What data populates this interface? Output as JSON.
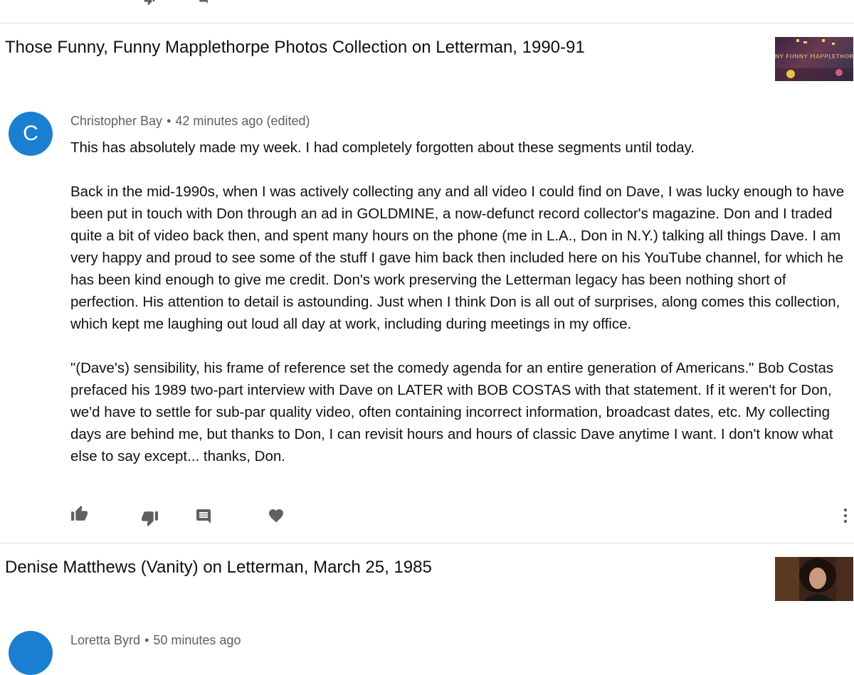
{
  "feed": {
    "items": [
      {
        "video_title": "Those Funny, Funny Mapplethorpe Photos Collection on Letterman, 1990-91",
        "thumbnail_text": "THOSE FUNNY FUNNY MAPPLETHORPE PHOTOS",
        "comment": {
          "avatar_letter": "C",
          "author": "Christopher Bay",
          "separator": "•",
          "time": "42 minutes ago (edited)",
          "paragraphs": [
            "This has absolutely made my week.  I had completely forgotten about these segments until today.",
            "Back in the mid-1990s, when I was actively collecting any and all video I could find on Dave, I was lucky enough to have been put in touch with Don through an ad in GOLDMINE, a now-defunct record collector's magazine. Don and I traded quite a bit of video back then, and spent many hours on the phone (me in L.A., Don in N.Y.) talking all things Dave. I am very happy and proud to see some of the stuff I gave him back then included here on his YouTube channel, for which he has been kind enough to give me credit.  Don's work preserving the Letterman legacy has been nothing short of perfection. His attention to detail is astounding. Just when I think Don is all out of surprises, along comes this collection, which kept me laughing out loud all day at work, including during meetings in my office.",
            "\"(Dave's) sensibility, his frame of reference set the comedy agenda for an entire generation of Americans.\" Bob Costas prefaced his 1989 two-part interview with Dave on LATER with BOB COSTAS with that statement. If it weren't for Don, we'd have to settle for sub-par quality video, often containing incorrect information, broadcast dates, etc. My collecting days are behind me, but thanks to Don, I can revisit hours and hours of classic Dave anytime I want. I don't know what else to say except... thanks, Don."
          ],
          "actions": [
            "like-icon",
            "dislike-icon",
            "reply-icon",
            "heart-icon",
            "more-menu-icon"
          ]
        }
      },
      {
        "video_title": "Denise Matthews (Vanity) on Letterman, March 25, 1985",
        "comment": {
          "author": "Loretta Byrd",
          "separator": "•",
          "time": "50 minutes ago"
        }
      }
    ]
  },
  "colors": {
    "avatar": "#1a7fd1",
    "icon": "#606060",
    "meta_text": "#606060",
    "divider": "#dddddd"
  }
}
